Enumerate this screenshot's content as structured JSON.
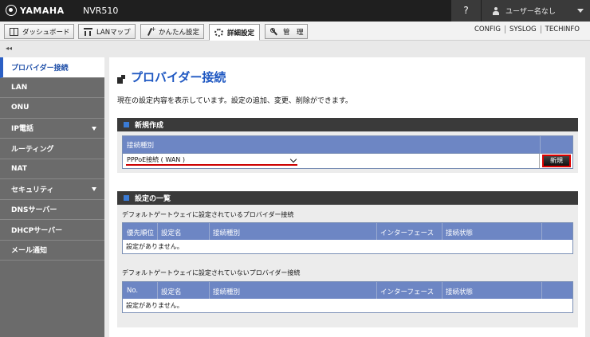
{
  "header": {
    "brand": "YAMAHA",
    "model": "NVR510",
    "help_label": "?",
    "user_name": "ユーザー名なし"
  },
  "tabs": [
    {
      "label": "ダッシュボード",
      "icon": "dashboard-icon"
    },
    {
      "label": "LANマップ",
      "icon": "lan-map-icon"
    },
    {
      "label": "かんたん設定",
      "icon": "easy-setup-icon"
    },
    {
      "label": "詳細設定",
      "icon": "gear-icon",
      "active": true
    },
    {
      "label": "管　理",
      "icon": "wrench-icon"
    }
  ],
  "top_links": [
    "CONFIG",
    "SYSLOG",
    "TECHINFO"
  ],
  "collapse_label": "◂◂",
  "sidebar": {
    "items": [
      {
        "label": "プロバイダー接続",
        "active": true
      },
      {
        "label": "LAN"
      },
      {
        "label": "ONU"
      },
      {
        "label": "IP電話",
        "expandable": true
      },
      {
        "label": "ルーティング"
      },
      {
        "label": "NAT"
      },
      {
        "label": "セキュリティ",
        "expandable": true
      },
      {
        "label": "DNSサーバー"
      },
      {
        "label": "DHCPサーバー"
      },
      {
        "label": "メール通知"
      }
    ]
  },
  "main": {
    "title": "プロバイダー接続",
    "description": "現在の設定内容を表示しています。設定の追加、変更、削除ができます。",
    "new_section": {
      "heading": "新規作成",
      "column_header": "接続種別",
      "selected_type": "PPPoE接続 ( WAN )",
      "new_button": "新規"
    },
    "list_section": {
      "heading": "設定の一覧",
      "default_caption": "デフォルトゲートウェイに設定されているプロバイダー接続",
      "default_columns": [
        "優先順位",
        "設定名",
        "接続種別",
        "インターフェース",
        "接続状態"
      ],
      "default_empty": "設定がありません。",
      "nondefault_caption": "デフォルトゲートウェイに設定されていないプロバイダー接続",
      "nondefault_columns": [
        "No.",
        "設定名",
        "接続種別",
        "インターフェース",
        "接続状態"
      ],
      "nondefault_empty": "設定がありません。"
    }
  },
  "colors": {
    "accent_blue": "#1f58c2",
    "table_header": "#6d86c4",
    "highlight_red": "#dd0000"
  }
}
